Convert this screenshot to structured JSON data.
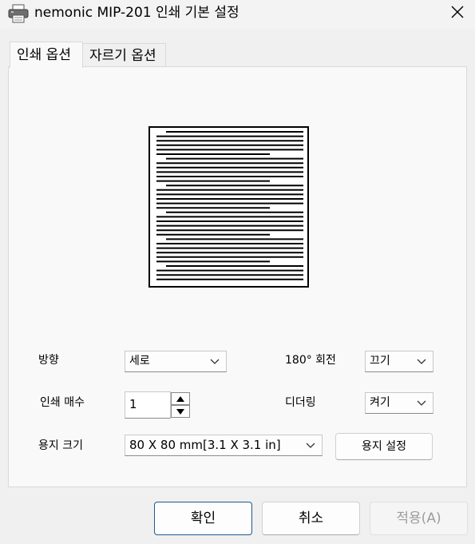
{
  "window": {
    "title": "nemonic MIP-201 인쇄 기본 설정",
    "icon": "printer-icon",
    "close_icon": "close-icon"
  },
  "tabs": [
    {
      "label": "인쇄 옵션",
      "active": true
    },
    {
      "label": "자르기 옵션",
      "active": false
    }
  ],
  "preview": {
    "icon": "page-preview-icon",
    "orientation": "portrait"
  },
  "form": {
    "orientation": {
      "label": "방향",
      "value": "세로"
    },
    "rotate180": {
      "label": "180° 회전",
      "value": "끄기"
    },
    "copies": {
      "label": "인쇄 매수",
      "value": "1"
    },
    "dithering": {
      "label": "디더링",
      "value": "켜기"
    },
    "paper_size": {
      "label": "용지 크기",
      "value": "80 X 80 mm[3.1 X 3.1 in]"
    },
    "paper_setup_button": "용지 설정"
  },
  "footer": {
    "ok": "확인",
    "cancel": "취소",
    "apply": "적용(A)"
  },
  "colors": {
    "primary_border": "#1f5a8c",
    "disabled_text": "#9d9d9d"
  }
}
